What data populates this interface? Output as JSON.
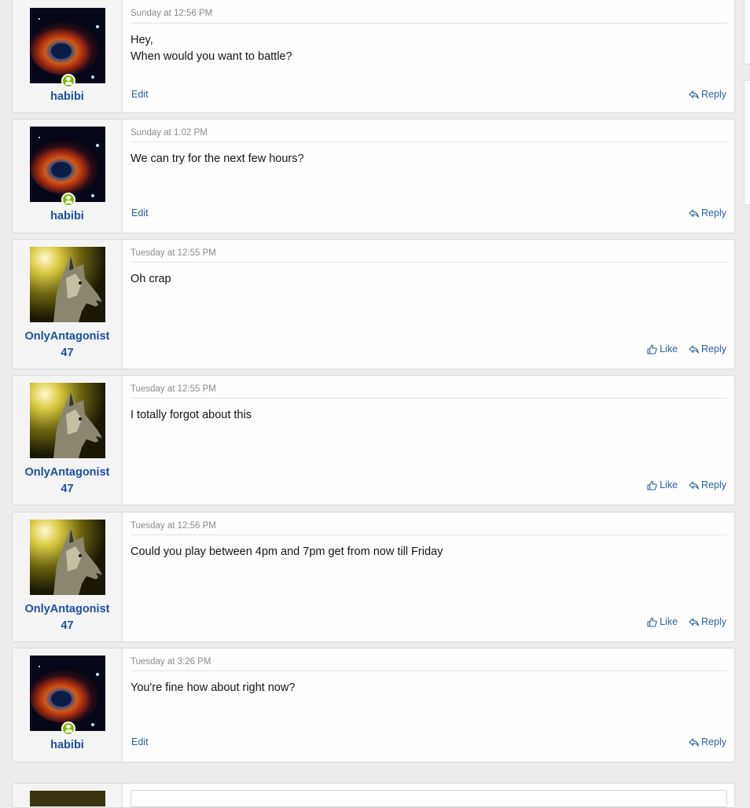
{
  "posts": [
    {
      "user": "habibi",
      "avatar": "nebula-avatar",
      "online": true,
      "date": "Sunday at 12:56 PM",
      "body": "Hey,\nWhen would you want to battle?",
      "own": true,
      "edit_label": "Edit",
      "reply_label": "Reply"
    },
    {
      "user": "habibi",
      "avatar": "nebula-avatar",
      "online": true,
      "date": "Sunday at 1:02 PM",
      "body": "We can try for the next few hours?",
      "own": true,
      "edit_label": "Edit",
      "reply_label": "Reply"
    },
    {
      "user": "OnlyAntagonist\n47",
      "avatar": "wolf-avatar",
      "online": false,
      "date": "Tuesday at 12:55 PM",
      "body": "Oh crap",
      "own": false,
      "like_label": "Like",
      "reply_label": "Reply"
    },
    {
      "user": "OnlyAntagonist\n47",
      "avatar": "wolf-avatar",
      "online": false,
      "date": "Tuesday at 12:55 PM",
      "body": "I totally forgot about this",
      "own": false,
      "like_label": "Like",
      "reply_label": "Reply"
    },
    {
      "user": "OnlyAntagonist\n47",
      "avatar": "wolf-avatar",
      "online": false,
      "date": "Tuesday at 12:56 PM",
      "body": "Could you play between 4pm and 7pm get from now till Friday",
      "own": false,
      "like_label": "Like",
      "reply_label": "Reply"
    },
    {
      "user": "habibi",
      "avatar": "nebula-avatar",
      "online": true,
      "date": "Tuesday at 3:26 PM",
      "body": "You're fine how about right now?",
      "own": true,
      "edit_label": "Edit",
      "reply_label": "Reply"
    }
  ],
  "colors": {
    "link": "#2a5f9e",
    "username": "#1e50a0",
    "online": "#7fb900",
    "background": "#ececec"
  }
}
